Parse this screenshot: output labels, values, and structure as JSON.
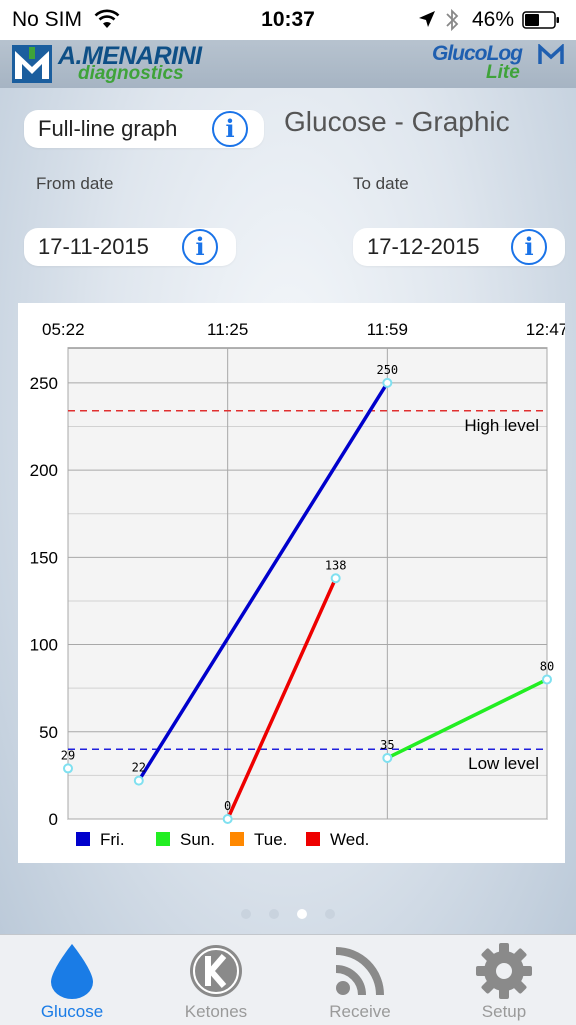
{
  "status_bar": {
    "carrier": "No SIM",
    "time": "10:37",
    "battery": "46%"
  },
  "brand": {
    "company": "A.MENARINI",
    "company_sub": "diagnostics",
    "app": "GlucoLog",
    "app_sub": "Lite"
  },
  "graph_mode": {
    "label": "Full-line graph",
    "info_icon": "info-icon"
  },
  "page_title": "Glucose - Graphic",
  "from_date": {
    "label": "From date",
    "value": "17-11-2015"
  },
  "to_date": {
    "label": "To date",
    "value": "17-12-2015"
  },
  "colors": {
    "accent": "#1a7ce6",
    "fri": "#0000cc",
    "sun": "#22ee22",
    "tue": "#ff8800",
    "wed": "#ee0000",
    "high_line": "#e03030",
    "low_line": "#2020dd"
  },
  "chart_data": {
    "type": "line",
    "x_ticks": [
      "05:22",
      "11:25",
      "11:59",
      "12:47"
    ],
    "y_ticks": [
      "0",
      "50",
      "100",
      "150",
      "200",
      "250"
    ],
    "ylim": [
      0,
      270
    ],
    "grid": true,
    "reference_lines": [
      {
        "name": "High level",
        "value": 234
      },
      {
        "name": "Low level",
        "value": 40
      }
    ],
    "series": [
      {
        "name": "Fri.",
        "color": "#0000cc",
        "points": [
          {
            "x": "08:03",
            "y": 22
          },
          {
            "x": "11:59",
            "y": 250
          }
        ]
      },
      {
        "name": "Sun.",
        "color": "#22ee22",
        "points": [
          {
            "x": "11:59",
            "y": 35
          },
          {
            "x": "12:47",
            "y": 80
          }
        ]
      },
      {
        "name": "Tue.",
        "color": "#ff8800",
        "points": []
      },
      {
        "name": "Wed.",
        "color": "#ee0000",
        "points": [
          {
            "x": "11:25",
            "y": 0
          },
          {
            "x": "11:48",
            "y": 138
          }
        ]
      }
    ],
    "isolated_points": [
      {
        "x": "05:22",
        "y": 29
      }
    ],
    "legend_position": "bottom-left"
  },
  "pager": {
    "count": 4,
    "active": 2
  },
  "tabs": [
    {
      "label": "Glucose",
      "icon": "drop-icon",
      "active": true
    },
    {
      "label": "Ketones",
      "icon": "ketone-k-icon",
      "active": false
    },
    {
      "label": "Receive",
      "icon": "signal-icon",
      "active": false
    },
    {
      "label": "Setup",
      "icon": "gear-icon",
      "active": false
    }
  ]
}
